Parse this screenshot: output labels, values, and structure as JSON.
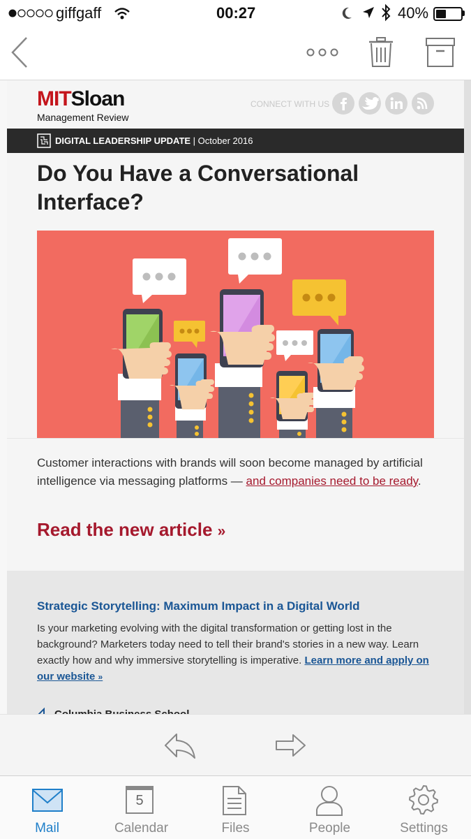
{
  "status_bar": {
    "carrier": "giffgaff",
    "time": "00:27",
    "battery": "40%",
    "battery_level": 0.4
  },
  "nav": {
    "icons": [
      "back-chevron-icon",
      "more-dots-icon",
      "trash-icon",
      "archive-icon"
    ]
  },
  "email": {
    "brand": {
      "logo_mit": "MIT",
      "logo_sloan": "Sloan",
      "logo_sub": "Management Review"
    },
    "connect_label": "CONNECT WITH US",
    "social_icons": [
      "facebook-icon",
      "twitter-icon",
      "linkedin-icon",
      "rss-icon"
    ],
    "banner": {
      "title": "DIGITAL LEADERSHIP UPDATE",
      "separator": " | ",
      "date": "October 2016"
    },
    "headline": "Do You Have a Conversational Interface?",
    "body_text": "Customer interactions with brands will soon become managed by artificial intelligence via messaging platforms — ",
    "body_link": "and companies need to be ready",
    "body_end": ".",
    "cta": "Read the new article",
    "cta_arrow": "»",
    "promo": {
      "title": "Strategic Storytelling: Maximum Impact in a Digital World",
      "text": "Is your marketing evolving with the digital transformation or getting lost in the background? Marketers today need to tell their brand's stories in a new way. Learn exactly how and why immersive storytelling is imperative. ",
      "link": "Learn more and apply on our website",
      "link_arrow": "»",
      "partner": "Columbia Business School"
    },
    "colors": {
      "brand_red": "#a5192d",
      "illustration_bg": "#f26b60",
      "promo_blue": "#1a5695"
    }
  },
  "actions": {
    "icons": [
      "reply-icon",
      "forward-icon"
    ]
  },
  "tabs": [
    {
      "label": "Mail",
      "active": true
    },
    {
      "label": "Calendar",
      "day": "5"
    },
    {
      "label": "Files"
    },
    {
      "label": "People"
    },
    {
      "label": "Settings"
    }
  ]
}
